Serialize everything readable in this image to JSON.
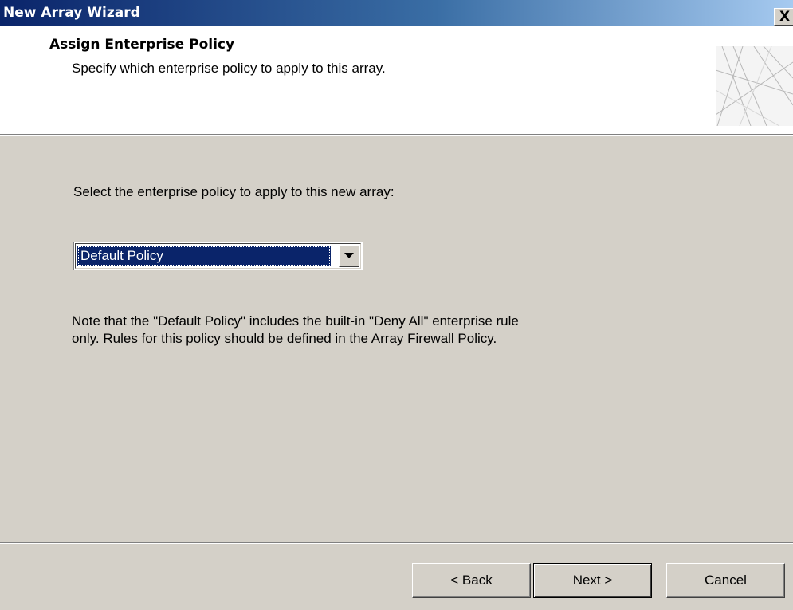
{
  "window": {
    "title": "New Array Wizard",
    "close_label": "X"
  },
  "header": {
    "title": "Assign Enterprise Policy",
    "subtitle": "Specify which enterprise policy to apply to this array."
  },
  "content": {
    "prompt": "Select the enterprise policy to apply to this new array:",
    "policy_select": {
      "selected": "Default Policy"
    },
    "note_line1": "Note that the \"Default Policy\" includes the built-in \"Deny All\" enterprise rule",
    "note_line2": "only. Rules for this policy should be defined in the Array Firewall Policy."
  },
  "buttons": {
    "back": "< Back",
    "next": "Next >",
    "cancel": "Cancel"
  },
  "colors": {
    "titlebar_start": "#0a246a",
    "titlebar_end": "#a6caf0",
    "dialog_bg": "#d4d0c8",
    "selection_bg": "#0a246a"
  },
  "icons": {
    "header_graphic": "wizard-banner-graphic",
    "dropdown_arrow": "chevron-down-icon"
  }
}
